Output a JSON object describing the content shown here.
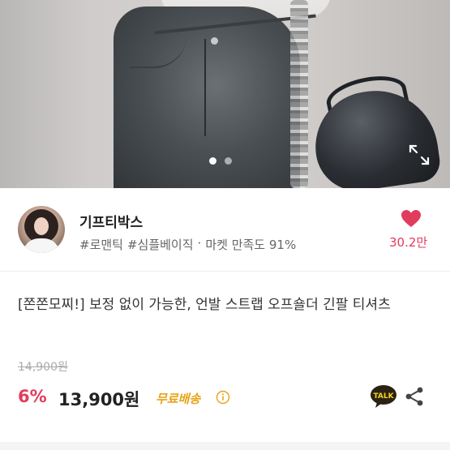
{
  "photo": {
    "slide_count": 2,
    "active_slide": 1,
    "expand_icon": "expand-icon"
  },
  "shop": {
    "name": "기프티박스",
    "tags": [
      "#로맨틱",
      "#심플베이직",
      "·",
      "마켓 만족도 91%"
    ],
    "likes": "30.2만",
    "heart_color": "#e23c5d"
  },
  "product": {
    "title": "[쫀쫀모찌!] 보정 없이 가능한, 언발 스트랩 오프숄더 긴팔 티셔츠",
    "original_price": "14,900원",
    "discount": "6%",
    "price": "13,900원",
    "shipping": "무료배송",
    "talk_label": "TALK"
  },
  "colors": {
    "accent": "#e23c5d",
    "shipping": "#e8a317"
  }
}
